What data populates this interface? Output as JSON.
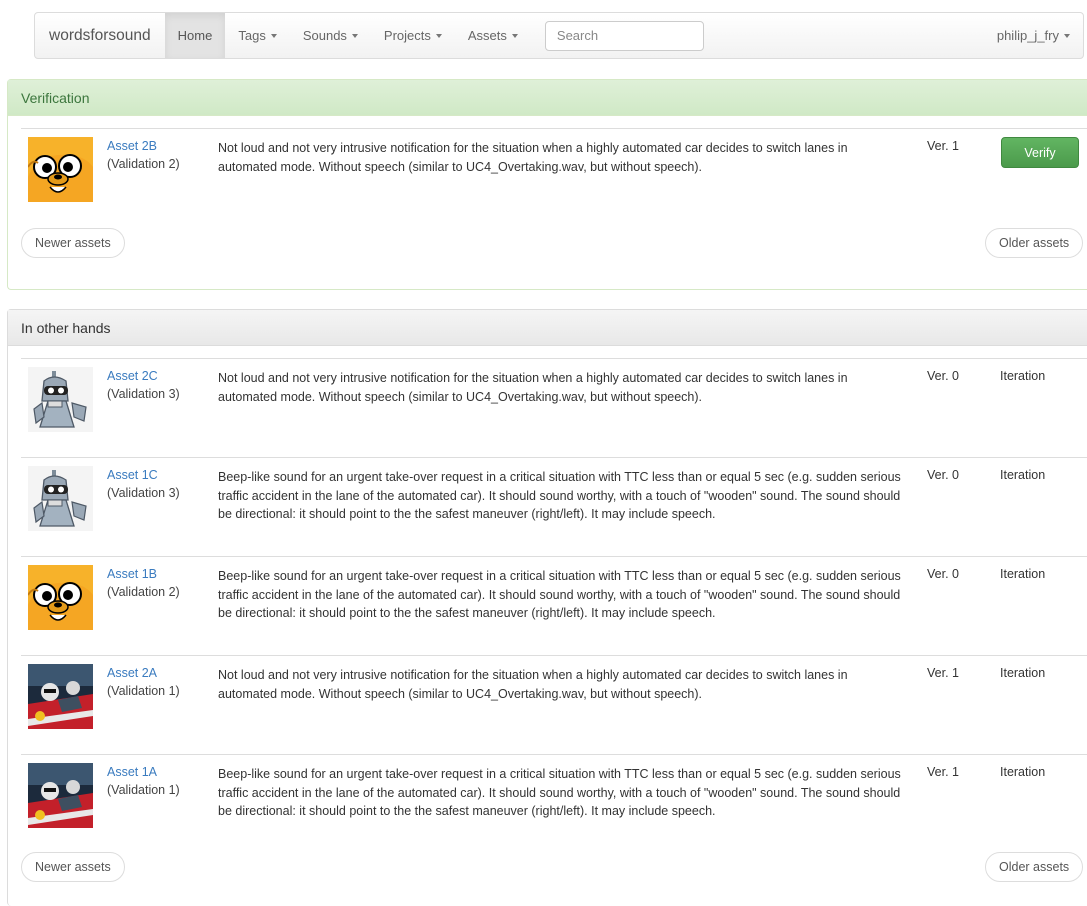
{
  "navbar": {
    "brand": "wordsforsound",
    "home": "Home",
    "tags": "Tags",
    "sounds": "Sounds",
    "projects": "Projects",
    "assets": "Assets",
    "search_placeholder": "Search",
    "user": "philip_j_fry"
  },
  "verification": {
    "heading": "Verification",
    "rows": [
      {
        "asset": "Asset 2B",
        "validation": "(Validation 2)",
        "description": "Not loud and not very intrusive notification for the situation when a highly automated car decides to switch lanes in automated mode. Without speech (similar to UC4_Overtaking.wav, but without speech).",
        "version": "Ver. 1",
        "action": "Verify",
        "avatar": "jake-avatar"
      }
    ],
    "newer": "Newer assets",
    "older": "Older assets"
  },
  "other_hands": {
    "heading": "In other hands",
    "rows": [
      {
        "asset": "Asset 2C",
        "validation": "(Validation 3)",
        "description": "Not loud and not very intrusive notification for the situation when a highly automated car decides to switch lanes in automated mode. Without speech (similar to UC4_Overtaking.wav, but without speech).",
        "version": "Ver. 0",
        "state": "Iteration",
        "avatar": "bender-avatar"
      },
      {
        "asset": "Asset 1C",
        "validation": "(Validation 3)",
        "description": "Beep-like sound for an urgent take-over request in a critical situation with TTC less than or equal 5 sec (e.g. sudden serious traffic accident in the lane of the automated car). It should sound worthy, with a touch of \"wooden\" sound. The sound should be directional: it should point to the the safest maneuver (right/left). It may include speech.",
        "version": "Ver. 0",
        "state": "Iteration",
        "avatar": "bender-avatar"
      },
      {
        "asset": "Asset 1B",
        "validation": "(Validation 2)",
        "description": "Beep-like sound for an urgent take-over request in a critical situation with TTC less than or equal 5 sec (e.g. sudden serious traffic accident in the lane of the automated car). It should sound worthy, with a touch of \"wooden\" sound. The sound should be directional: it should point to the the safest maneuver (right/left). It may include speech.",
        "version": "Ver. 0",
        "state": "Iteration",
        "avatar": "jake-avatar"
      },
      {
        "asset": "Asset 2A",
        "validation": "(Validation 1)",
        "description": "Not loud and not very intrusive notification for the situation when a highly automated car decides to switch lanes in automated mode. Without speech (similar to UC4_Overtaking.wav, but without speech).",
        "version": "Ver. 1",
        "state": "Iteration",
        "avatar": "racer-avatar"
      },
      {
        "asset": "Asset 1A",
        "validation": "(Validation 1)",
        "description": "Beep-like sound for an urgent take-over request in a critical situation with TTC less than or equal 5 sec (e.g. sudden serious traffic accident in the lane of the automated car). It should sound worthy, with a touch of \"wooden\" sound. The sound should be directional: it should point to the the safest maneuver (right/left). It may include speech.",
        "version": "Ver. 1",
        "state": "Iteration",
        "avatar": "racer-avatar"
      }
    ],
    "newer": "Newer assets",
    "older": "Older assets"
  },
  "colors": {
    "link": "#3a7bbf",
    "verify_button": "#5cb85c",
    "success_heading": "#dff0d8"
  }
}
